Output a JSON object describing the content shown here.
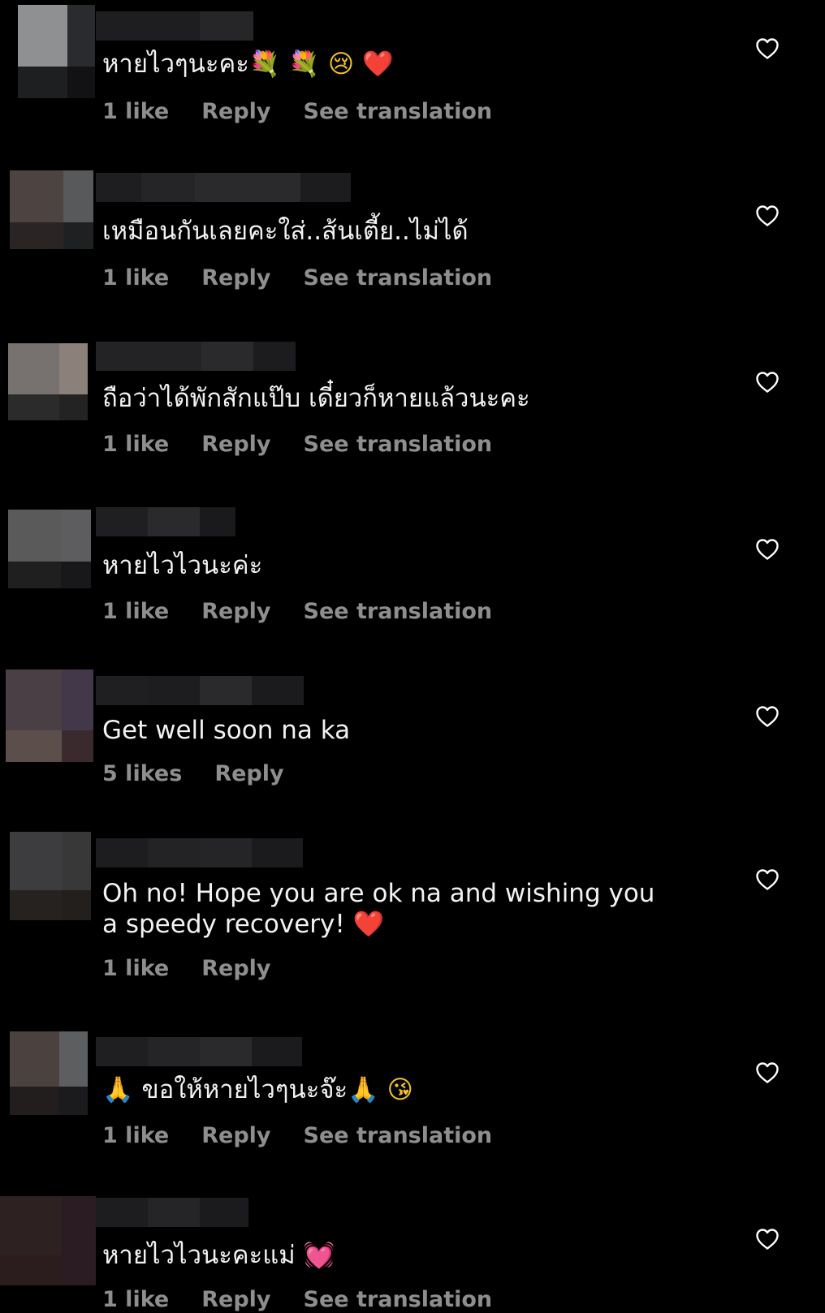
{
  "actions": {
    "reply": "Reply",
    "see_translation": "See translation"
  },
  "icons": {
    "like": "heart-outline-icon"
  },
  "comments": [
    {
      "text": "หายไวๆนะคะ",
      "emojis": [
        "💐",
        "💐",
        "😢",
        "❤️"
      ],
      "likes": "1 like",
      "has_translation": true
    },
    {
      "text": "เหมือนกันเลยคะใส่..ส้นเตี้ย..ไม่ได้",
      "emojis": [],
      "likes": "1 like",
      "has_translation": true
    },
    {
      "text": "ถือว่าได้พักสักแป๊บ เดี๋ยวก็หายแล้วนะคะ",
      "emojis": [],
      "likes": "1 like",
      "has_translation": true
    },
    {
      "text": "หายไวไวนะค่ะ",
      "emojis": [],
      "likes": "1 like",
      "has_translation": true
    },
    {
      "text": "Get well soon na ka",
      "emojis": [],
      "likes": "5 likes",
      "has_translation": false
    },
    {
      "text": "Oh no! Hope you are ok na and wishing you a speedy recovery!",
      "emojis": [
        "❤️"
      ],
      "likes": "1 like",
      "has_translation": false
    },
    {
      "text_prefix_emoji": "🙏",
      "text": "ขอให้หายไวๆนะจ๊ะ",
      "emojis": [
        "🙏",
        "😘"
      ],
      "likes": "1 like",
      "has_translation": true
    },
    {
      "text": "หายไวไวนะคะแม่",
      "emojis": [
        "💓"
      ],
      "likes": "1 like",
      "has_translation": true
    }
  ],
  "colors": {
    "background": "#000000",
    "text": "#f2f2f2",
    "meta": "#8e8e8e",
    "heart_emoji": "#e0152b"
  }
}
